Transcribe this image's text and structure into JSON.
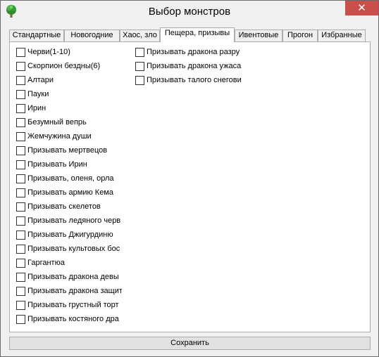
{
  "window": {
    "title": "Выбор монстров",
    "close_glyph": "✕"
  },
  "tabs": [
    {
      "label": "Стандартные",
      "active": false
    },
    {
      "label": "Новогодние",
      "active": false
    },
    {
      "label": "Хаос, зло",
      "active": false
    },
    {
      "label": "Пещера, призывы",
      "active": true
    },
    {
      "label": "Ивентовые",
      "active": false
    },
    {
      "label": "Прогон",
      "active": false
    },
    {
      "label": "Избранные",
      "active": false
    }
  ],
  "checkboxes_col1": [
    {
      "label": "Черви(1-10)",
      "checked": false
    },
    {
      "label": "Скорпион бездны(6)",
      "checked": false
    },
    {
      "label": "Алтари",
      "checked": false
    },
    {
      "label": "Пауки",
      "checked": false
    },
    {
      "label": "Ирин",
      "checked": false
    },
    {
      "label": "Безумный вепрь",
      "checked": false
    },
    {
      "label": "Жемчужина души",
      "checked": false
    },
    {
      "label": "Призывать мертвецов",
      "checked": false
    },
    {
      "label": "Призывать Ирин",
      "checked": false
    },
    {
      "label": "Призывать, оленя, орла",
      "checked": false
    },
    {
      "label": "Призывать армию Кема",
      "checked": false
    },
    {
      "label": "Призывать скелетов",
      "checked": false
    },
    {
      "label": "Призывать ледяного черв",
      "checked": false
    },
    {
      "label": "Призывать Джигурдиню",
      "checked": false
    },
    {
      "label": "Призывать культовых бос",
      "checked": false
    },
    {
      "label": "Гаргантюа",
      "checked": false
    },
    {
      "label": "Призывать дракона девы",
      "checked": false
    },
    {
      "label": "Призывать дракона защит",
      "checked": false
    },
    {
      "label": "Призывать грустный торт",
      "checked": false
    },
    {
      "label": "Призывать костяного дра",
      "checked": false
    }
  ],
  "checkboxes_col2": [
    {
      "label": "Призывать дракона разру",
      "checked": false
    },
    {
      "label": "Призывать дракона ужаса",
      "checked": false
    },
    {
      "label": "Призывать талого снегови",
      "checked": false
    }
  ],
  "save_label": "Сохранить"
}
